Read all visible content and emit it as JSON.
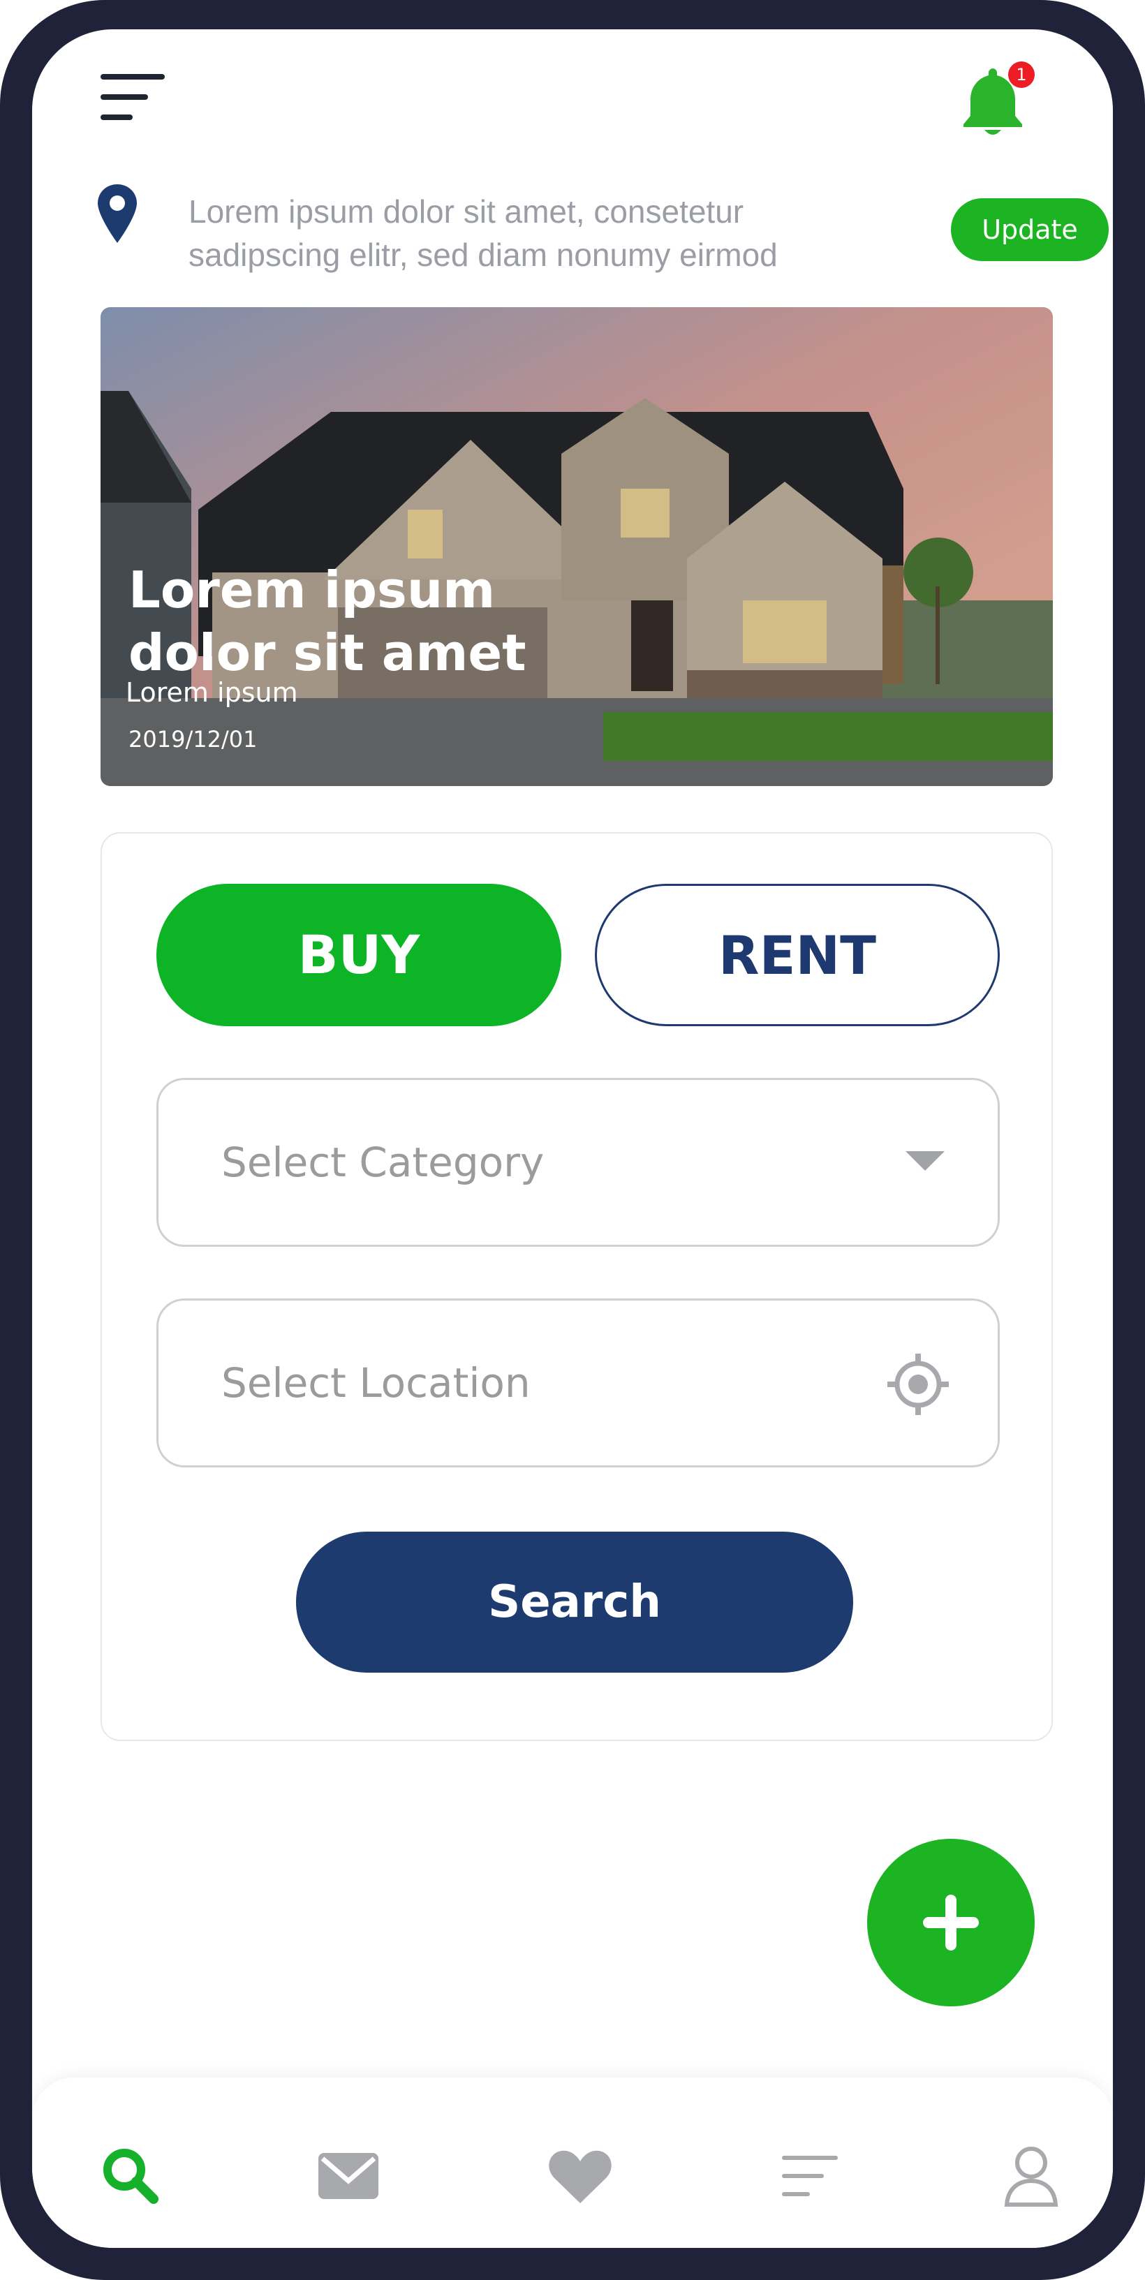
{
  "header": {
    "menu_icon": "hamburger-menu-icon",
    "notification_icon": "bell-icon",
    "notification_count": "1",
    "notification_color": "#2ab32b"
  },
  "location": {
    "icon": "map-pin-icon",
    "address": "Lorem ipsum dolor sit amet, consetetur sadipscing elitr, sed diam nonumy eirmod",
    "update_label": "Update"
  },
  "hero": {
    "title": "Lorem ipsum dolor sit amet",
    "subtitle": "Lorem ipsum",
    "date": "2019/12/01"
  },
  "search_form": {
    "buy_label": "BUY",
    "rent_label": "RENT",
    "active_tab": "BUY",
    "category_placeholder": "Select Category",
    "location_placeholder": "Select Location",
    "search_label": "Search"
  },
  "fab": {
    "icon": "plus-icon"
  },
  "bottom_nav": {
    "items": [
      {
        "icon": "search-icon",
        "active": true
      },
      {
        "icon": "mail-icon",
        "active": false
      },
      {
        "icon": "heart-icon",
        "active": false
      },
      {
        "icon": "list-icon",
        "active": false
      },
      {
        "icon": "user-icon",
        "active": false
      }
    ]
  },
  "colors": {
    "accent_green": "#1db424",
    "navy": "#1e3b6f",
    "text_gray": "#9b9b9e",
    "badge_red": "#ee1c25"
  }
}
